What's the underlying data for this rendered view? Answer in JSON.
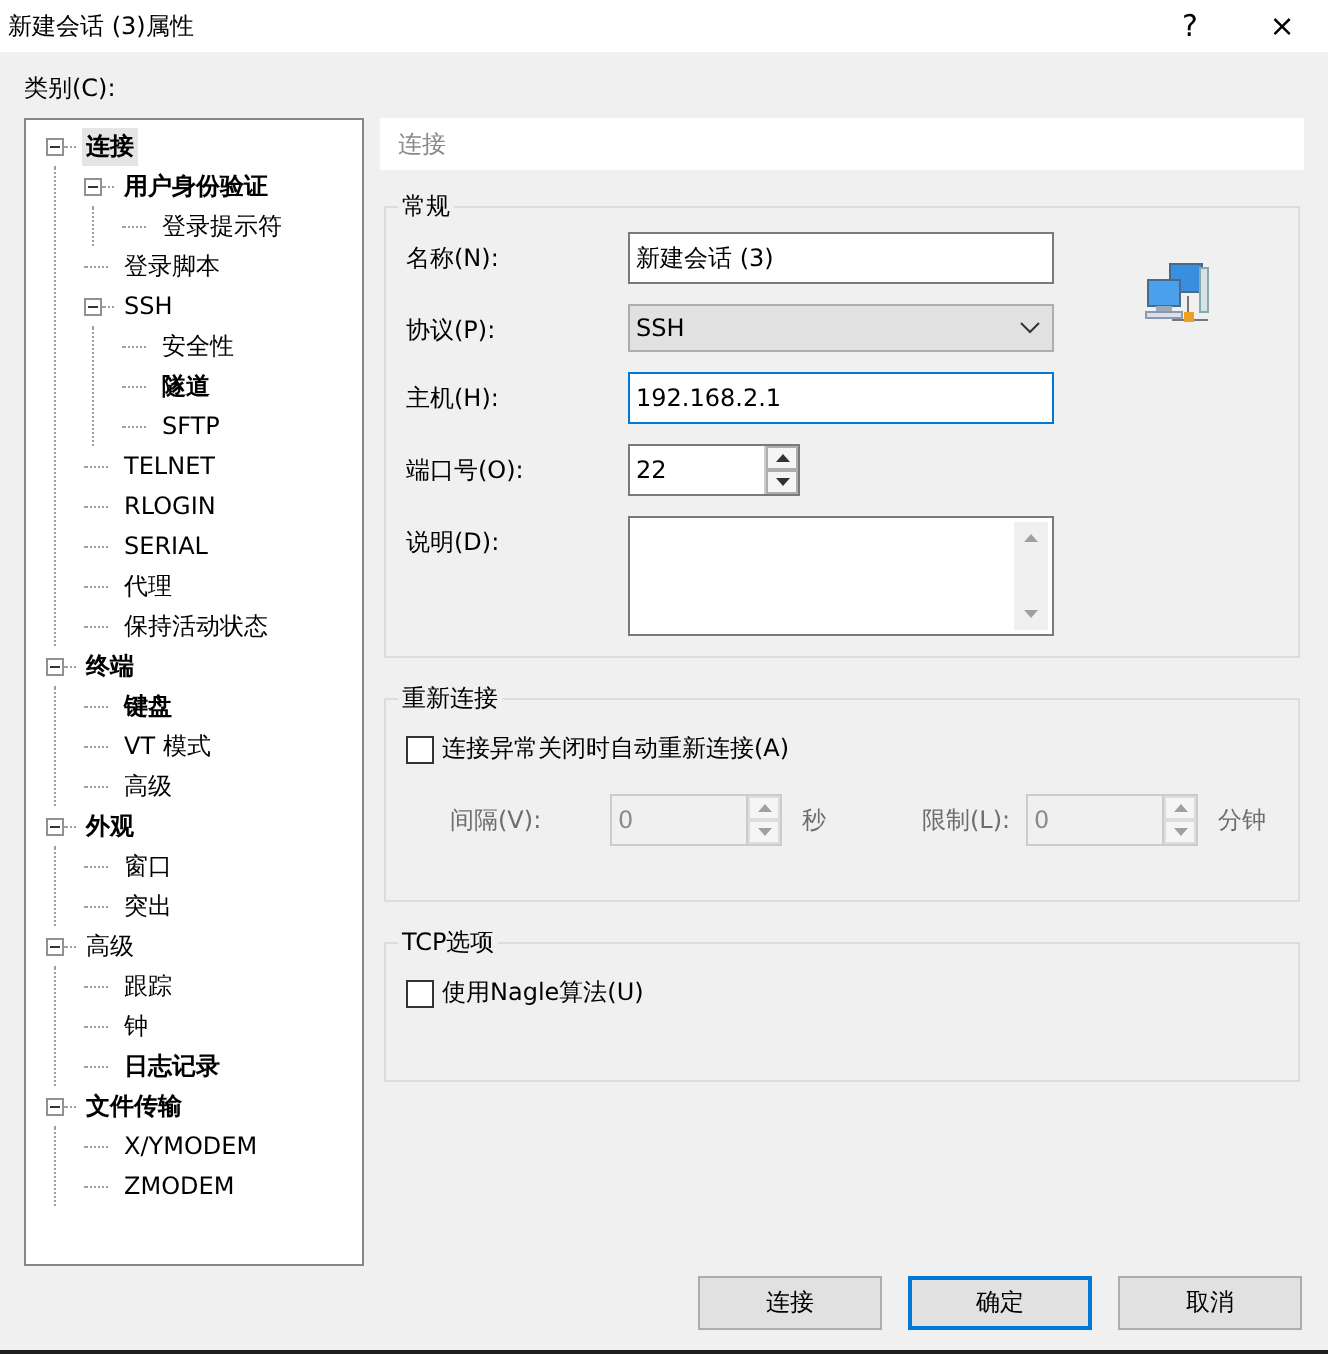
{
  "window": {
    "title": "新建会话 (3)属性",
    "help": "?",
    "close": "×"
  },
  "category_label": "类别(C):",
  "tree": [
    {
      "label": "连接",
      "bold": true,
      "selected": true,
      "expanded": true,
      "children": [
        {
          "label": "用户身份验证",
          "bold": true,
          "selected": false,
          "expanded": true,
          "children": [
            {
              "label": "登录提示符",
              "bold": false,
              "selected": false
            }
          ]
        },
        {
          "label": "登录脚本",
          "bold": false,
          "selected": false
        },
        {
          "label": "SSH",
          "bold": false,
          "selected": false,
          "expanded": true,
          "children": [
            {
              "label": "安全性",
              "bold": false,
              "selected": false
            },
            {
              "label": "隧道",
              "bold": true,
              "selected": false
            },
            {
              "label": "SFTP",
              "bold": false,
              "selected": false
            }
          ]
        },
        {
          "label": "TELNET",
          "bold": false,
          "selected": false
        },
        {
          "label": "RLOGIN",
          "bold": false,
          "selected": false
        },
        {
          "label": "SERIAL",
          "bold": false,
          "selected": false
        },
        {
          "label": "代理",
          "bold": false,
          "selected": false
        },
        {
          "label": "保持活动状态",
          "bold": false,
          "selected": false
        }
      ]
    },
    {
      "label": "终端",
      "bold": true,
      "selected": false,
      "expanded": true,
      "children": [
        {
          "label": "键盘",
          "bold": true,
          "selected": false
        },
        {
          "label": "VT 模式",
          "bold": false,
          "selected": false
        },
        {
          "label": "高级",
          "bold": false,
          "selected": false
        }
      ]
    },
    {
      "label": "外观",
      "bold": true,
      "selected": false,
      "expanded": true,
      "children": [
        {
          "label": "窗口",
          "bold": false,
          "selected": false
        },
        {
          "label": "突出",
          "bold": false,
          "selected": false
        }
      ]
    },
    {
      "label": "高级",
      "bold": false,
      "selected": false,
      "expanded": true,
      "children": [
        {
          "label": "跟踪",
          "bold": false,
          "selected": false
        },
        {
          "label": "钟",
          "bold": false,
          "selected": false
        },
        {
          "label": "日志记录",
          "bold": true,
          "selected": false
        }
      ]
    },
    {
      "label": "文件传输",
      "bold": true,
      "selected": false,
      "expanded": true,
      "children": [
        {
          "label": "X/YMODEM",
          "bold": false,
          "selected": false
        },
        {
          "label": "ZMODEM",
          "bold": false,
          "selected": false
        }
      ]
    }
  ],
  "section_header": "连接",
  "general": {
    "title": "常规",
    "fields": [
      {
        "kind": "text",
        "label": "名称(N):",
        "value": "新建会话 (3)",
        "focused": false
      },
      {
        "kind": "select",
        "label": "协议(P):",
        "value": "SSH"
      },
      {
        "kind": "text",
        "label": "主机(H):",
        "value": "192.168.2.1",
        "focused": true
      },
      {
        "kind": "spin",
        "label": "端口号(O):",
        "value": "22"
      },
      {
        "kind": "memo",
        "label": "说明(D):"
      }
    ]
  },
  "reconnect": {
    "title": "重新连接",
    "checkbox": {
      "label": "连接异常关闭时自动重新连接(A)",
      "checked": false
    },
    "interval": {
      "label": "间隔(V):",
      "value": "0",
      "unit": "秒",
      "disabled": true
    },
    "limit": {
      "label": "限制(L):",
      "value": "0",
      "unit": "分钟",
      "disabled": true
    }
  },
  "tcp": {
    "title": "TCP选项",
    "checkbox": {
      "label": "使用Nagle算法(U)",
      "checked": false
    }
  },
  "buttons": [
    {
      "label": "连接",
      "default": false
    },
    {
      "label": "确定",
      "default": true
    },
    {
      "label": "取消",
      "default": false
    }
  ]
}
